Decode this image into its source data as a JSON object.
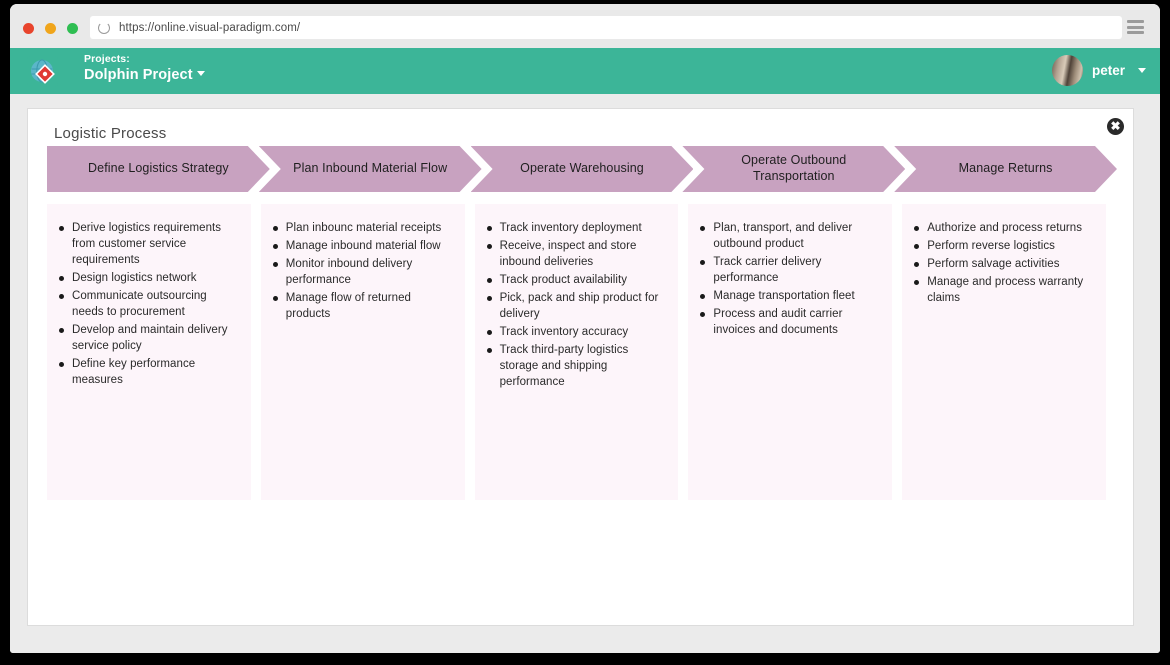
{
  "browser": {
    "url": "https://online.visual-paradigm.com/",
    "reload_icon": "reload-icon",
    "menu_icon": "hamburger-menu-icon",
    "traffic_lights": [
      "close-red",
      "minimize-amber",
      "maximize-green"
    ]
  },
  "app_header": {
    "logo_icon": "visual-paradigm-logo-icon",
    "projects_label": "Projects:",
    "project_name": "Dolphin Project",
    "project_caret_icon": "chevron-down-icon",
    "user_name": "peter",
    "user_caret_icon": "chevron-down-icon",
    "avatar_icon": "user-avatar",
    "background_color": "#3cb598"
  },
  "card": {
    "title": "Logistic Process",
    "close_label": "✖",
    "close_icon": "close-icon"
  },
  "diagram": {
    "chevron_color": "#c8a2c0",
    "panel_color": "#fdf5fa",
    "stages": [
      {
        "title": "Define Logistics Strategy",
        "items": [
          "Derive logistics requirements from customer service requirements",
          "Design logistics network",
          "Communicate outsourcing needs to procurement",
          "Develop and maintain delivery service policy",
          "Define key performance measures"
        ]
      },
      {
        "title": "Plan Inbound Material Flow",
        "items": [
          "Plan inbounc material receipts",
          "Manage inbound material flow",
          "Monitor inbound delivery performance",
          "Manage flow of returned products"
        ]
      },
      {
        "title": "Operate Warehousing",
        "items": [
          "Track inventory deployment",
          "Receive, inspect and store inbound deliveries",
          "Track product availability",
          "Pick, pack and ship product for delivery",
          "Track inventory accuracy",
          "Track third-party logistics storage and shipping performance"
        ]
      },
      {
        "title": "Operate Outbound Transportation",
        "items": [
          "Plan, transport, and deliver outbound product",
          "Track carrier delivery performance",
          "Manage transportation fleet",
          "Process and audit carrier invoices and documents"
        ]
      },
      {
        "title": "Manage Returns",
        "items": [
          "Authorize and process returns",
          "Perform reverse logistics",
          "Perform salvage activities",
          "Manage and process warranty claims"
        ]
      }
    ]
  }
}
